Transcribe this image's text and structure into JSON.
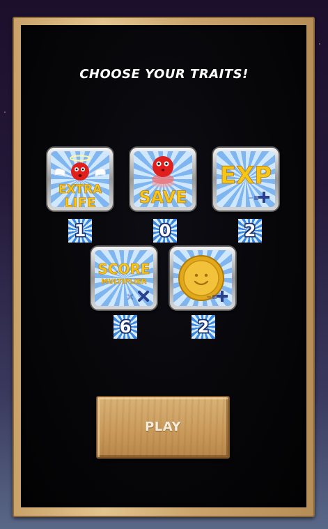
{
  "screen": {
    "title": "CHOOSE YOUR TRAITS!",
    "play_label": "PLAY"
  },
  "traits": [
    {
      "name": "extra-life",
      "label_line1": "EXTRA",
      "label_line2": "LIFE",
      "count": "1"
    },
    {
      "name": "save",
      "label": "SAVE",
      "count": "0"
    },
    {
      "name": "exp",
      "label": "EXP",
      "count": "2"
    },
    {
      "name": "score-multiplier",
      "label_line1": "SCORE",
      "label_line2": "MULTIPLIER",
      "count": "6"
    },
    {
      "name": "coin",
      "count": "2"
    }
  ],
  "colors": {
    "tile_ray_light": "#cfe8ff",
    "tile_ray_dark": "#7fb6ef",
    "label_yellow": "#f5c518",
    "ball_red": "#e0201c",
    "frame_wood": "#c9a26a",
    "board": "#050507"
  }
}
